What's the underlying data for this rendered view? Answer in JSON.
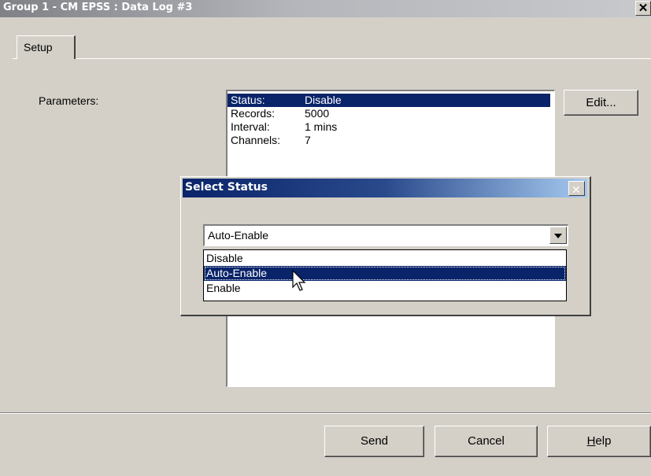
{
  "window": {
    "title": "Group 1 - CM EPSS : Data Log #3",
    "close_label": "✕"
  },
  "tabs": [
    {
      "label": "Setup"
    }
  ],
  "params": {
    "label": "Parameters:",
    "rows": [
      {
        "key": "Status:",
        "value": "Disable"
      },
      {
        "key": "Records:",
        "value": "5000"
      },
      {
        "key": "Interval:",
        "value": "1 mins"
      },
      {
        "key": "Channels:",
        "value": "7"
      }
    ],
    "edit_button": "Edit..."
  },
  "footer": {
    "send": "Send",
    "cancel": "Cancel",
    "help": "Help"
  },
  "dialog": {
    "title": "Select Status",
    "close_label": "✕",
    "combo_value": "Auto-Enable",
    "options": [
      {
        "label": "Disable"
      },
      {
        "label": "Auto-Enable"
      },
      {
        "label": "Enable"
      }
    ]
  },
  "colors": {
    "face": "#d4d0c8",
    "selection": "#0a246a",
    "active_title": "#0a246a",
    "inactive_title": "#7f8187"
  }
}
